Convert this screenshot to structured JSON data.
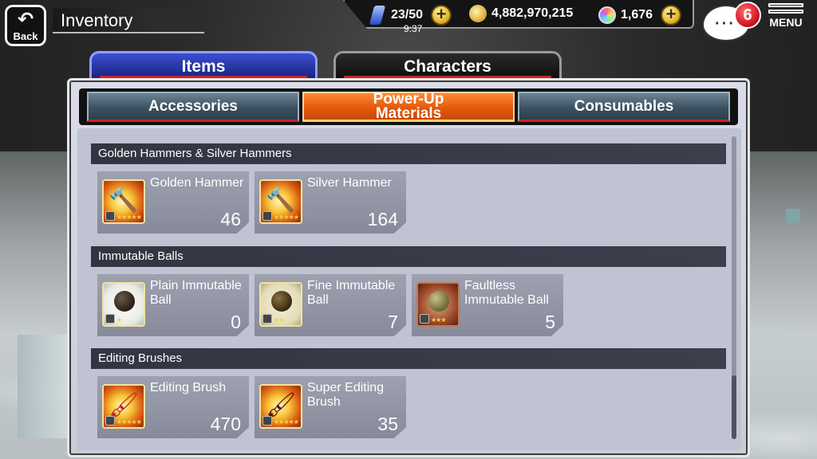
{
  "header": {
    "back_label": "Back",
    "title": "Inventory"
  },
  "resources": {
    "stamina": "23/50",
    "coins": "4,882,970,215",
    "orbs": "1,676",
    "time": "9:37"
  },
  "notifications": {
    "chat_count": "6"
  },
  "menu": {
    "label": "MENU"
  },
  "main_tabs": [
    {
      "label": "Items",
      "active": true
    },
    {
      "label": "Characters",
      "active": false
    }
  ],
  "sub_tabs": [
    {
      "label": "Accessories",
      "active": false
    },
    {
      "label": "Power-Up Materials",
      "active": true
    },
    {
      "label": "Consumables",
      "active": false
    }
  ],
  "sections": [
    {
      "title": "Golden Hammers & Silver Hammers",
      "items": [
        {
          "name": "Golden Hammer",
          "qty": "46",
          "icon": "golden-hammer-icon",
          "stars": 5
        },
        {
          "name": "Silver Hammer",
          "qty": "164",
          "icon": "silver-hammer-icon",
          "stars": 5
        }
      ]
    },
    {
      "title": "Immutable Balls",
      "items": [
        {
          "name": "Plain Immutable Ball",
          "qty": "0",
          "icon": "plain-immutable-ball-icon",
          "stars": 1
        },
        {
          "name": "Fine Immutable Ball",
          "qty": "7",
          "icon": "fine-immutable-ball-icon",
          "stars": 2
        },
        {
          "name": "Faultless Immutable Ball",
          "qty": "5",
          "icon": "faultless-immutable-ball-icon",
          "stars": 3
        }
      ]
    },
    {
      "title": "Editing Brushes",
      "items": [
        {
          "name": "Editing Brush",
          "qty": "470",
          "icon": "editing-brush-icon",
          "stars": 5
        },
        {
          "name": "Super Editing Brush",
          "qty": "35",
          "icon": "super-editing-brush-icon",
          "stars": 5
        }
      ]
    }
  ],
  "colors": {
    "active_tab": "#e45a0a",
    "items_tab": "#2a3ab0",
    "accent_red": "#c7232b"
  }
}
